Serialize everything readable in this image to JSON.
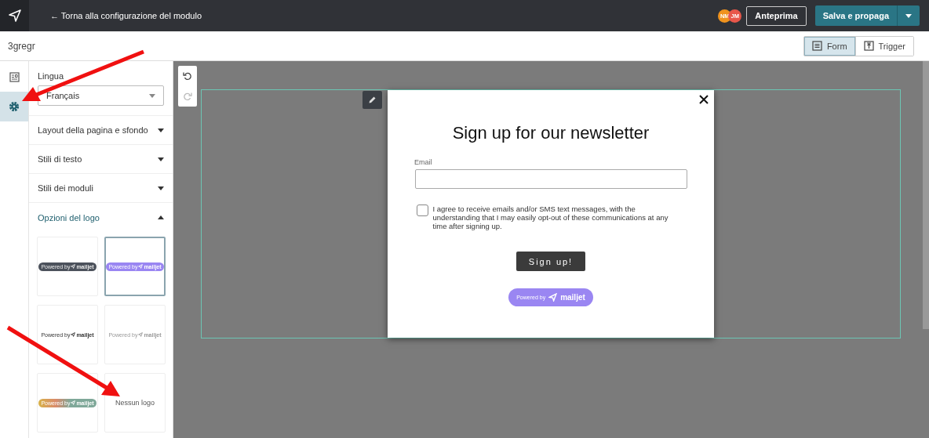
{
  "topbar": {
    "back_link": "← Torna alla configurazione del modulo",
    "avatars": [
      {
        "initials": "NM",
        "color": "#f0931e"
      },
      {
        "initials": "JM",
        "color": "#e8574a"
      }
    ],
    "preview_button": "Anteprima",
    "save_button": "Salva e propaga"
  },
  "toolbar": {
    "form_name": "3gregr",
    "view_toggle": [
      {
        "kind": "form",
        "label": "Form",
        "selected": true
      },
      {
        "kind": "trigger",
        "label": "Trigger",
        "selected": false
      }
    ]
  },
  "rail": [
    {
      "kind": "form",
      "selected": false
    },
    {
      "kind": "settings",
      "selected": true
    }
  ],
  "panel": {
    "language": {
      "label": "Lingua",
      "value": "Français"
    },
    "sections": [
      {
        "label": "Layout della pagina e sfondo",
        "expanded": false
      },
      {
        "label": "Stili di testo",
        "expanded": false
      },
      {
        "label": "Stili dei moduli",
        "expanded": false
      },
      {
        "label": "Opzioni del logo",
        "expanded": true
      }
    ],
    "logo_options": [
      {
        "kind": "dark",
        "text": "Powered by",
        "brand": "mailjet",
        "selected": false
      },
      {
        "kind": "purple",
        "text": "Powered by",
        "brand": "mailjet",
        "selected": true
      },
      {
        "kind": "plain-dark",
        "text": "Powered by",
        "brand": "mailjet",
        "selected": false
      },
      {
        "kind": "plain-light",
        "text": "Powered by",
        "brand": "mailjet",
        "selected": false
      },
      {
        "kind": "gradient",
        "text": "Powered by",
        "brand": "mailjet",
        "selected": false
      },
      {
        "kind": "none",
        "text": "Nessun logo",
        "selected": false
      }
    ]
  },
  "form": {
    "title": "Sign up for our newsletter",
    "email_label": "Email",
    "consent": {
      "checked": false,
      "text": "I agree to receive emails and/or SMS text messages, with the understanding that I may easily opt-out of these communications at any time after signing up."
    },
    "submit": "Sign up!",
    "badge": {
      "text": "Powered by",
      "brand": "mailjet"
    }
  }
}
